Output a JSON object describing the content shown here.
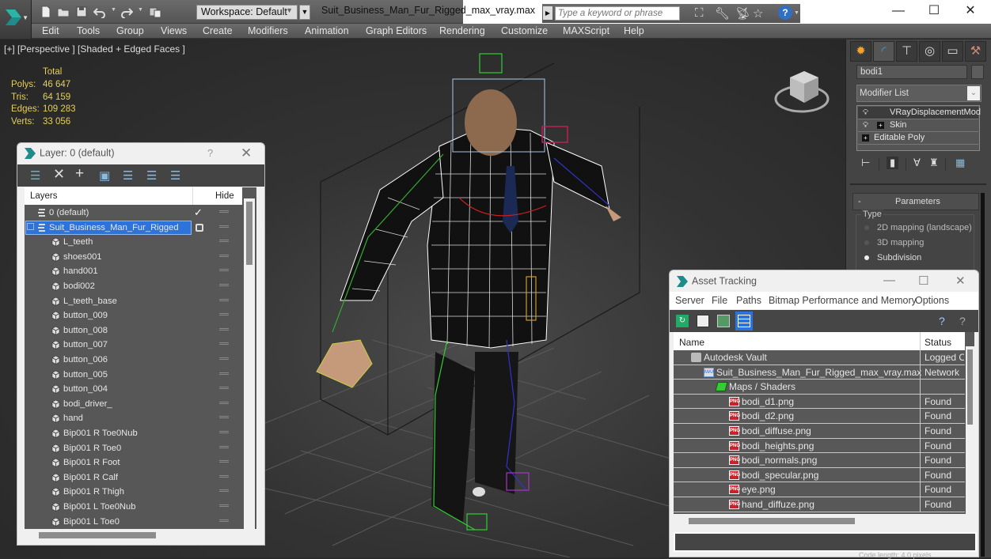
{
  "app": {
    "workspace": "Workspace: Default",
    "document_title": "Suit_Business_Man_Fur_Rigged_max_vray.max",
    "search_placeholder": "Type a keyword or phrase",
    "window_controls": [
      "minimize",
      "maximize",
      "close"
    ]
  },
  "quick_access": [
    "new-file-icon",
    "open-folder-icon",
    "save-icon",
    "undo-icon",
    "redo-icon",
    "project-folder-icon"
  ],
  "search_tools": [
    "binoculars-icon",
    "wrench-icon",
    "satellite-icon",
    "star-icon",
    "help-icon"
  ],
  "menu": [
    "Edit",
    "Tools",
    "Group",
    "Views",
    "Create",
    "Modifiers",
    "Animation",
    "Graph Editors",
    "Rendering",
    "Customize",
    "MAXScript",
    "Help"
  ],
  "viewport": {
    "label": "[+] [Perspective ] [Shaded + Edged Faces ]",
    "stats": {
      "header": "Total",
      "rows": [
        {
          "label": "Polys:",
          "value": "46 647"
        },
        {
          "label": "Tris:",
          "value": "64 159"
        },
        {
          "label": "Edges:",
          "value": "109 283"
        },
        {
          "label": "Verts:",
          "value": "33 056"
        }
      ]
    }
  },
  "layer_dialog": {
    "title": "Layer: 0 (default)",
    "help": "?",
    "toolbar": [
      "create-layer-icon",
      "delete-layer-icon",
      "add-to-layer-icon",
      "select-objects-icon",
      "select-layer-icon",
      "highlight-layer-icon",
      "hide-all-icon"
    ],
    "col_layers": "Layers",
    "col_hide": "Hide",
    "rows": [
      {
        "name": "0 (default)",
        "type": "layer",
        "indent": 0,
        "active": true
      },
      {
        "name": "Suit_Business_Man_Fur_Rigged",
        "type": "layer",
        "indent": 0,
        "selected": true
      },
      {
        "name": "L_teeth",
        "type": "object",
        "indent": 1
      },
      {
        "name": "shoes001",
        "type": "object",
        "indent": 1
      },
      {
        "name": "hand001",
        "type": "object",
        "indent": 1
      },
      {
        "name": "bodi002",
        "type": "object",
        "indent": 1
      },
      {
        "name": "L_teeth_base",
        "type": "object",
        "indent": 1
      },
      {
        "name": "button_009",
        "type": "object",
        "indent": 1
      },
      {
        "name": "button_008",
        "type": "object",
        "indent": 1
      },
      {
        "name": "button_007",
        "type": "object",
        "indent": 1
      },
      {
        "name": "button_006",
        "type": "object",
        "indent": 1
      },
      {
        "name": "button_005",
        "type": "object",
        "indent": 1
      },
      {
        "name": "button_004",
        "type": "object",
        "indent": 1
      },
      {
        "name": "bodi_driver_",
        "type": "object",
        "indent": 1
      },
      {
        "name": "hand",
        "type": "object",
        "indent": 1
      },
      {
        "name": "Bip001 R Toe0Nub",
        "type": "object",
        "indent": 1
      },
      {
        "name": "Bip001 R Toe0",
        "type": "object",
        "indent": 1
      },
      {
        "name": "Bip001 R Foot",
        "type": "object",
        "indent": 1
      },
      {
        "name": "Bip001 R Calf",
        "type": "object",
        "indent": 1
      },
      {
        "name": "Bip001 R Thigh",
        "type": "object",
        "indent": 1
      },
      {
        "name": "Bip001 L Toe0Nub",
        "type": "object",
        "indent": 1
      },
      {
        "name": "Bip001 L Toe0",
        "type": "object",
        "indent": 1
      }
    ]
  },
  "command_panel": {
    "tabs": [
      "create-icon",
      "modify-icon",
      "hierarchy-icon",
      "motion-icon",
      "display-icon",
      "utilities-icon"
    ],
    "active_tab": 1,
    "object_name": "bodi1",
    "modifier_list": "Modifier List",
    "stack": [
      {
        "name": "VRayDisplacementMod",
        "bulb": true,
        "expand": false,
        "selected": true
      },
      {
        "name": "Skin",
        "bulb": true,
        "expand": true
      },
      {
        "name": "Editable Poly",
        "bulb": false,
        "expand": true
      }
    ],
    "stack_tools": [
      "pin-stack-icon",
      "show-end-result-icon",
      "make-unique-icon",
      "remove-modifier-icon",
      "configure-sets-icon"
    ],
    "rollout_title": "Parameters",
    "rollout_toggle": "-",
    "type_group_label": "Type",
    "type_options": [
      {
        "label": "2D mapping (landscape)",
        "checked": false
      },
      {
        "label": "3D mapping",
        "checked": false
      },
      {
        "label": "Subdivision",
        "checked": true
      }
    ]
  },
  "asset_tracking": {
    "title": "Asset Tracking",
    "menu": [
      "Server",
      "File",
      "Paths",
      "Bitmap Performance and Memory",
      "Options"
    ],
    "toolbar": [
      "refresh-icon",
      "list-view-icon",
      "thumbnail-view-icon",
      "table-view-icon"
    ],
    "toolbar_right": [
      "help-icon",
      "context-help-icon"
    ],
    "col_name": "Name",
    "col_status": "Status",
    "rows": [
      {
        "name": "Autodesk Vault",
        "status": "Logged Out",
        "icon": "vault-icon",
        "indent": 0
      },
      {
        "name": "Suit_Business_Man_Fur_Rigged_max_vray.max",
        "status": "Network",
        "icon": "max-file-icon",
        "indent": 1
      },
      {
        "name": "Maps / Shaders",
        "status": "",
        "icon": "maps-folder-icon",
        "indent": 2
      },
      {
        "name": "bodi_d1.png",
        "status": "Found",
        "icon": "png-icon",
        "indent": 3
      },
      {
        "name": "bodi_d2.png",
        "status": "Found",
        "icon": "png-icon",
        "indent": 3
      },
      {
        "name": "bodi_diffuse.png",
        "status": "Found",
        "icon": "png-icon",
        "indent": 3
      },
      {
        "name": "bodi_heights.png",
        "status": "Found",
        "icon": "png-icon",
        "indent": 3
      },
      {
        "name": "bodi_normals.png",
        "status": "Found",
        "icon": "png-icon",
        "indent": 3
      },
      {
        "name": "bodi_specular.png",
        "status": "Found",
        "icon": "png-icon",
        "indent": 3
      },
      {
        "name": "eye.png",
        "status": "Found",
        "icon": "png-icon",
        "indent": 3
      },
      {
        "name": "hand_diffuze.png",
        "status": "Found",
        "icon": "png-icon",
        "indent": 3
      }
    ],
    "status_path": ""
  },
  "bottom_strip": "Code length: 4.0    pixels"
}
